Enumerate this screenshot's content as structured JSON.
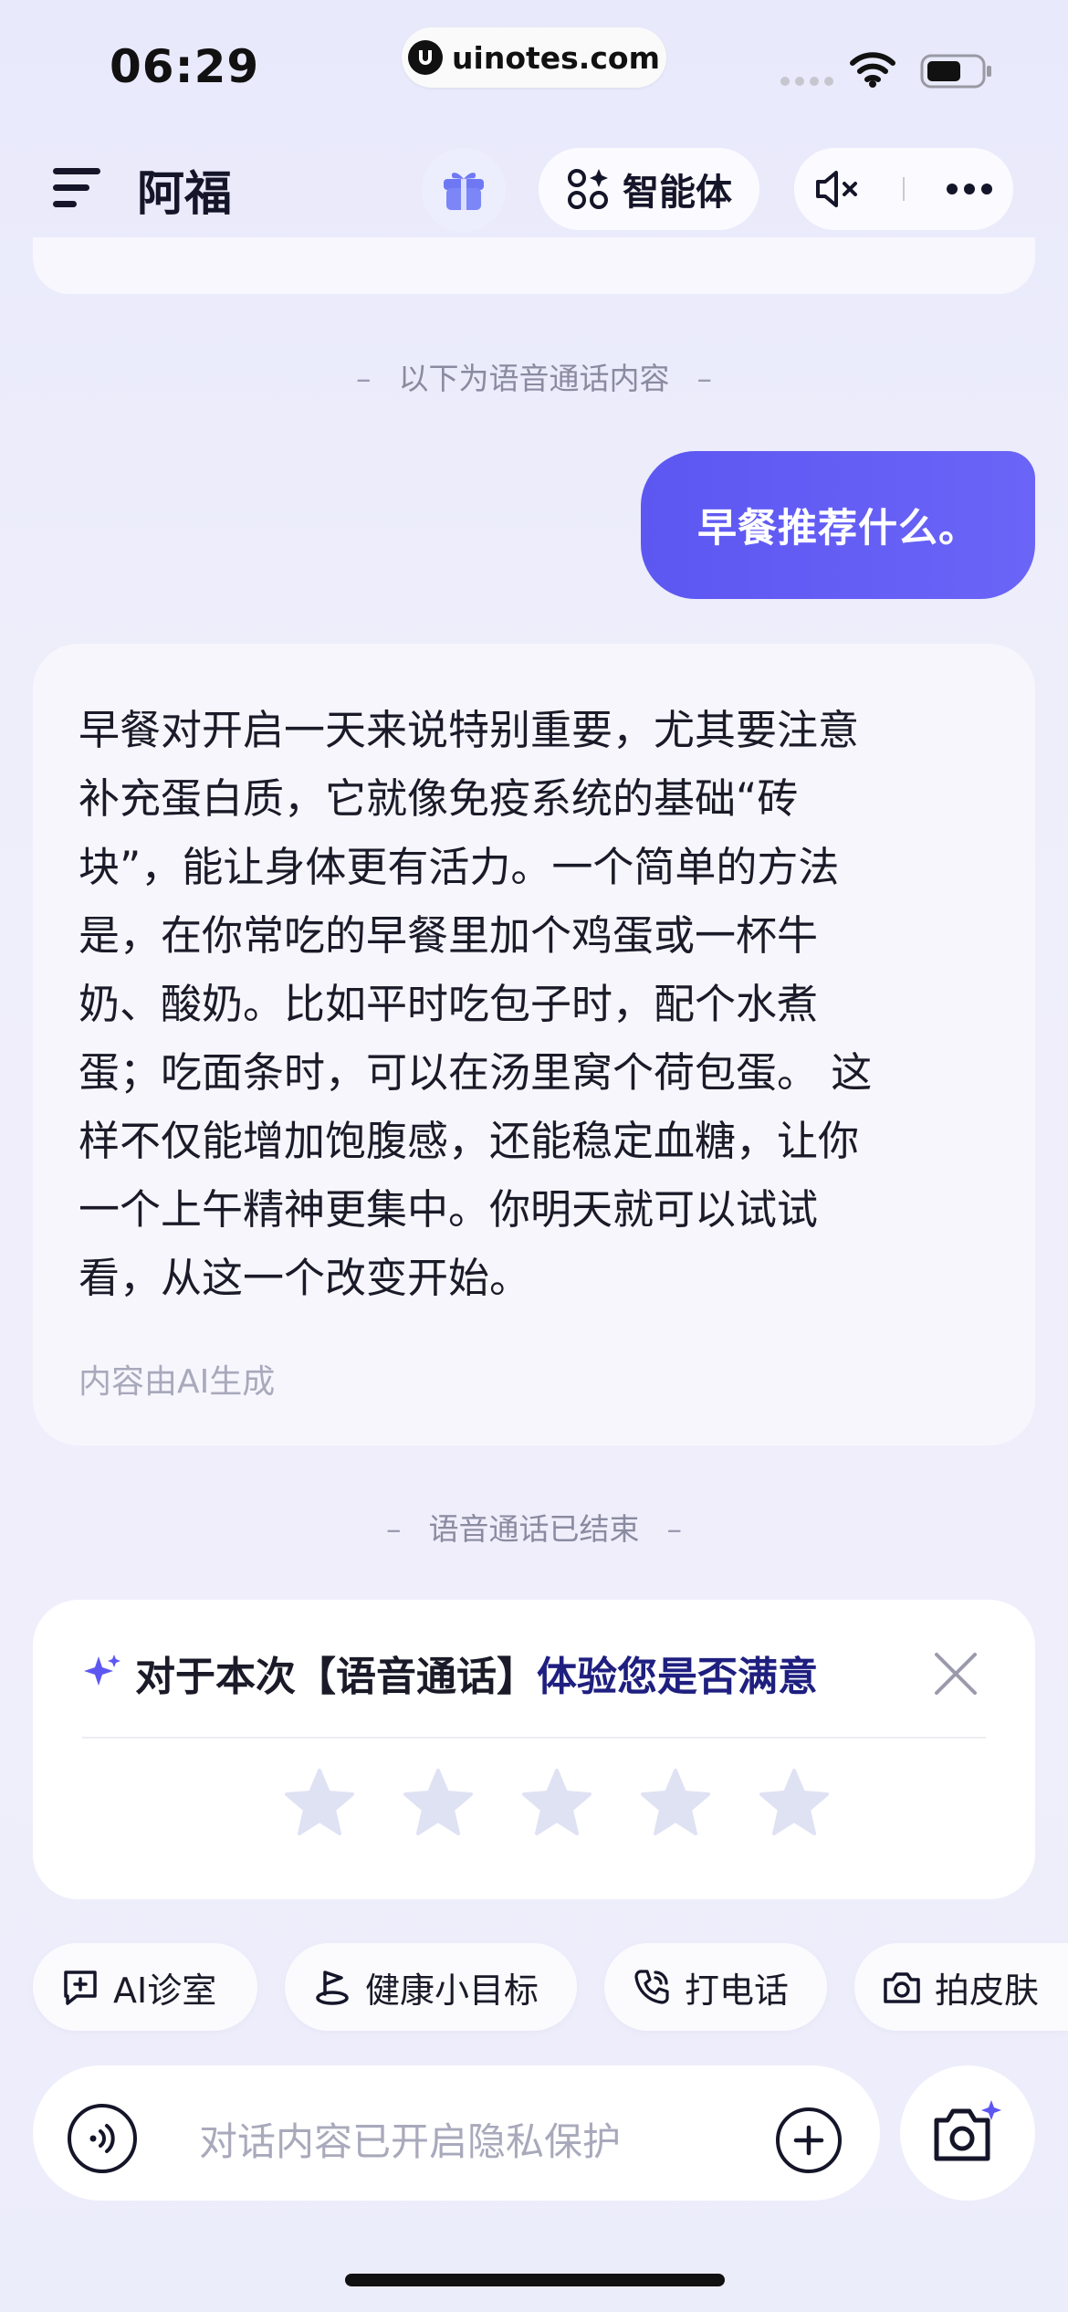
{
  "status_bar": {
    "time": "06:29",
    "url": "uinotes.com"
  },
  "header": {
    "title": "阿福",
    "agent_label": "智能体"
  },
  "conversation": {
    "voice_start_note": "以下为语音通话内容",
    "user_message": "早餐推荐什么。",
    "ai_lines": [
      "早餐对开启一天来说特别重要，尤其要注意",
      "补充蛋白质，它就像免疫系统的基础“砖",
      "块”，能让身体更有活力。一个简单的方法",
      "是，在你常吃的早餐里加个鸡蛋或一杯牛",
      "奶、酸奶。比如平时吃包子时，配个水煮",
      "蛋；吃面条时，可以在汤里窝个荷包蛋。 这",
      "样不仅能增加饱腹感，还能稳定血糖，让你",
      "一个上午精神更集中。你明天就可以试试",
      "看，从这一个改变开始。"
    ],
    "ai_note": "内容由AI生成",
    "voice_end_note": "语音通话已结束"
  },
  "rating": {
    "title_part1": "对于本次【语音通话】",
    "title_part2": "体验您是否满意",
    "stars": 5
  },
  "quick_actions": [
    {
      "label": "AI诊室",
      "icon": "chat-plus-icon"
    },
    {
      "label": "健康小目标",
      "icon": "flag-icon"
    },
    {
      "label": "打电话",
      "icon": "phone-icon"
    },
    {
      "label": "拍皮肤",
      "icon": "camera-icon"
    }
  ],
  "input": {
    "placeholder": "对话内容已开启隐私保护"
  },
  "colors": {
    "accent": "#5d57f2",
    "dark_navy": "#1f1f80",
    "star": "#dfe2f3"
  }
}
